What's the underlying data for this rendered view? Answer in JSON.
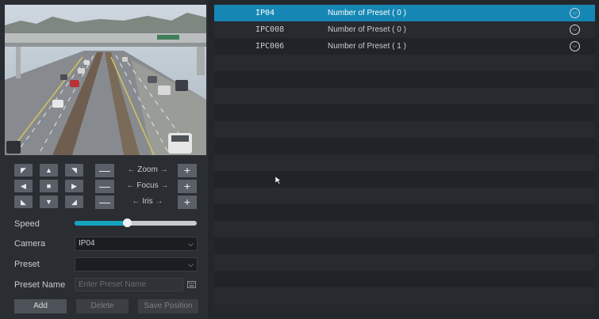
{
  "ptz": {
    "zoom_label": "Zoom",
    "focus_label": "Focus",
    "iris_label": "Iris",
    "minus_glyph": "—",
    "plus_glyph": "+"
  },
  "form": {
    "speed_label": "Speed",
    "speed_value": 0.43,
    "camera_label": "Camera",
    "camera_value": "IP04",
    "preset_label": "Preset",
    "preset_value": "",
    "preset_name_label": "Preset Name",
    "preset_name_placeholder": "Enter Preset Name"
  },
  "buttons": {
    "add": "Add",
    "delete": "Delete",
    "save_position": "Save Position"
  },
  "camera_list": [
    {
      "name": "IP04",
      "presets": "Number of Preset ( 0 )",
      "selected": true
    },
    {
      "name": "IPC008",
      "presets": "Number of Preset ( 0 )",
      "selected": false
    },
    {
      "name": "IPC006",
      "presets": "Number of Preset ( 1 )",
      "selected": false
    }
  ],
  "colors": {
    "selected_row": "#1687b5",
    "slider_fill": "#16a3c2"
  },
  "icons": {
    "expand": "chevron-down-circle-icon",
    "keyboard": "keyboard-icon"
  }
}
